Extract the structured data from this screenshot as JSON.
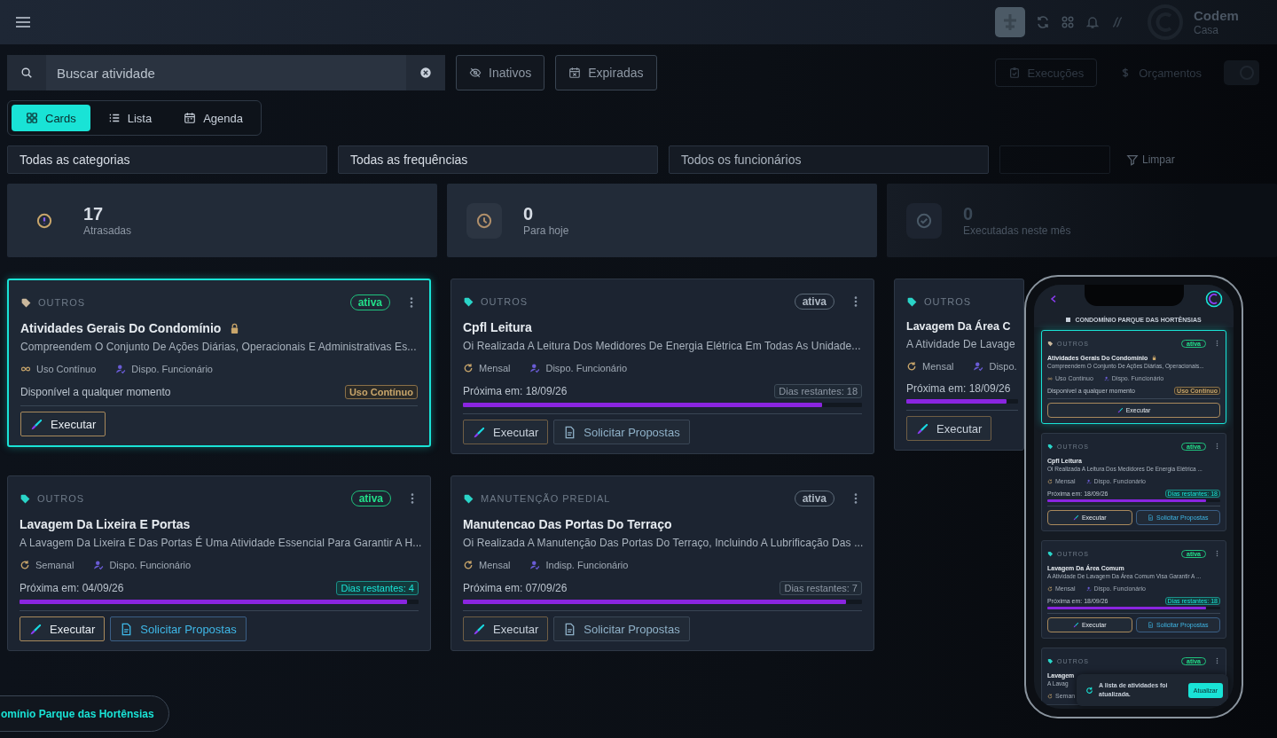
{
  "header": {
    "brand_name": "Codem",
    "brand_subtitle": "Casa"
  },
  "search": {
    "placeholder": "Buscar atividade"
  },
  "filter_buttons": [
    {
      "label": "Inativos",
      "kind": "inactive"
    },
    {
      "label": "Expiradas",
      "kind": "expired"
    }
  ],
  "nav_links": [
    {
      "label": "Execuções",
      "kind": "executions"
    },
    {
      "label": "Orçamentos",
      "kind": "budgets"
    }
  ],
  "view_tabs": [
    {
      "label": "Cards",
      "kind": "cards",
      "selected": true
    },
    {
      "label": "Lista",
      "kind": "list",
      "selected": false
    },
    {
      "label": "Agenda",
      "kind": "calendar",
      "selected": false
    }
  ],
  "filters": [
    {
      "label": "Todas as categorias"
    },
    {
      "label": "Todas as frequências"
    },
    {
      "label": "Todos os funcionários"
    }
  ],
  "clear_filters": "Limpar",
  "stats": [
    {
      "value": "17",
      "label": "Atrasadas",
      "kind": "overdue"
    },
    {
      "value": "0",
      "label": "Para hoje",
      "kind": "today"
    },
    {
      "value": "0",
      "label": "Executadas neste mês",
      "kind": "done"
    }
  ],
  "cards": [
    {
      "category": "OUTROS",
      "color": "#c9b79c",
      "status": "ativa",
      "emphasized": true,
      "highlighted": true,
      "title": "Atividades Gerais Do Condomínio",
      "locked": true,
      "description": "Compreendem O Conjunto De Ações Diárias, Operacionais E Administrativas Es...",
      "frequency": {
        "kind": "continuous",
        "label": "Uso Contínuo"
      },
      "staff": "Dispo. Funcionário",
      "footer": {
        "kind": "availability",
        "text": "Disponível a qualquer momento",
        "badge": "Uso Contínuo"
      },
      "buttons": [
        {
          "label": "Executar",
          "kind": "execute"
        }
      ]
    },
    {
      "category": "OUTROS",
      "color": "#2ad4c8",
      "status": "ativa",
      "emphasized": false,
      "highlighted": false,
      "title": "Cpfl Leitura",
      "locked": false,
      "description": "Oi Realizada A Leitura Dos Medidores De Energia Elétrica Em Todas As Unidade...",
      "frequency": {
        "kind": "recurring",
        "label": "Mensal"
      },
      "staff": "Dispo. Funcionário",
      "footer": {
        "kind": "schedule",
        "text": "Próxima em: 18/09/26",
        "badge": "Dias restantes: 18",
        "level": 0.9
      },
      "buttons": [
        {
          "label": "Executar",
          "kind": "execute"
        },
        {
          "label": "Solicitar Propostas",
          "kind": "proposals"
        }
      ]
    },
    {
      "category": "OUTROS",
      "color": "#2ad4c8",
      "highlighted": false,
      "title": "Lavagem Da Área C",
      "description": "A Atividade De Lavage",
      "frequency": {
        "kind": "recurring",
        "label": "Mensal"
      },
      "staff": "Dispo.",
      "footer": {
        "kind": "schedule",
        "text": "Próxima em: 18/09/26",
        "level": 0.9
      },
      "buttons": [
        {
          "label": "Executar",
          "kind": "execute"
        }
      ]
    },
    {
      "category": "OUTROS",
      "color": "#2ad4c8",
      "status": "ativa",
      "emphasized": true,
      "highlighted": false,
      "title": "Lavagem Da Lixeira E Portas",
      "locked": false,
      "description": "A Lavagem Da Lixeira E Das Portas É Uma Atividade Essencial Para Garantir A H...",
      "frequency": {
        "kind": "recurring",
        "label": "Semanal"
      },
      "staff": "Dispo. Funcionário",
      "footer": {
        "kind": "schedule",
        "text": "Próxima em: 04/09/26",
        "badge": "Dias restantes: 4",
        "level": 0.97
      },
      "buttons": [
        {
          "label": "Executar",
          "kind": "execute"
        },
        {
          "label": "Solicitar Propostas",
          "kind": "proposals"
        }
      ]
    },
    {
      "category": "MANUTENÇÃO PREDIAL",
      "color": "#2ad4c8",
      "status": "ativa",
      "emphasized": false,
      "highlighted": false,
      "title": "Manutencao Das Portas Do Terraço",
      "locked": false,
      "description": "Oi Realizada A Manutenção Das Portas Do Terraço, Incluindo A Lubrificação Das ...",
      "frequency": {
        "kind": "recurring",
        "label": "Mensal"
      },
      "staff": "Indisp. Funcionário",
      "footer": {
        "kind": "schedule",
        "text": "Próxima em: 07/09/26",
        "badge": "Dias restantes: 7",
        "level": 0.96
      },
      "buttons": [
        {
          "label": "Executar",
          "kind": "execute"
        },
        {
          "label": "Solicitar Propostas",
          "kind": "proposals"
        }
      ]
    }
  ],
  "location_pill": "omínio Parque das Hortênsias",
  "phone": {
    "title": "CONDOMÍNIO PARQUE DAS HORTÊNSIAS",
    "cards": [
      {
        "category": "OUTROS",
        "color": "#c9b79c",
        "status": "ativa",
        "emphasized": true,
        "highlighted": true,
        "title": "Atividades Gerais Do Condomínio",
        "locked": true,
        "description": "Compreendem O Conjunto De Ações Diárias, Operacionais...",
        "frequency": {
          "kind": "continuous",
          "label": "Uso Contínuo"
        },
        "staff": "Dispo. Funcionário",
        "footer": {
          "kind": "availability",
          "text": "Disponível a qualquer momento",
          "badge": "Uso Contínuo"
        },
        "buttons": [
          {
            "label": "Executar",
            "kind": "execute"
          }
        ]
      },
      {
        "category": "OUTROS",
        "color": "#2ad4c8",
        "status": "ativa",
        "emphasized": true,
        "highlighted": false,
        "title": "Cpfl Leitura",
        "locked": false,
        "description": "Oi Realizada A Leitura Dos Medidores De Energia Elétrica ...",
        "frequency": {
          "kind": "recurring",
          "label": "Mensal"
        },
        "staff": "Dispo. Funcionário",
        "footer": {
          "kind": "schedule",
          "text": "Próxima em: 18/09/26",
          "badge": "Dias restantes: 18",
          "level": 0.92
        },
        "buttons": [
          {
            "label": "Executar",
            "kind": "execute"
          },
          {
            "label": "Solicitar Propostas",
            "kind": "proposals"
          }
        ]
      },
      {
        "category": "OUTROS",
        "color": "#2ad4c8",
        "status": "ativa",
        "emphasized": true,
        "highlighted": false,
        "title": "Lavagem Da Área Comum",
        "locked": false,
        "description": "A Atividade De Lavagem Da Área Comum Visa Garantir A ...",
        "frequency": {
          "kind": "recurring",
          "label": "Mensal"
        },
        "staff": "Dispo. Funcionário",
        "footer": {
          "kind": "schedule",
          "text": "Próxima em: 18/09/26",
          "badge": "Dias restantes: 18",
          "level": 0.92
        },
        "buttons": [
          {
            "label": "Executar",
            "kind": "execute"
          },
          {
            "label": "Solicitar Propostas",
            "kind": "proposals"
          }
        ]
      },
      {
        "category": "OUTROS",
        "color": "#2ad4c8",
        "status": "ativa",
        "emphasized": true,
        "highlighted": false,
        "title": "Lavagem",
        "locked": false,
        "description": "A Lavag",
        "frequency": {
          "kind": "recurring",
          "label": "Seman"
        }
      }
    ],
    "toast": {
      "message": "A lista de atividades foi atualizada.",
      "action": "Atualizar"
    }
  }
}
